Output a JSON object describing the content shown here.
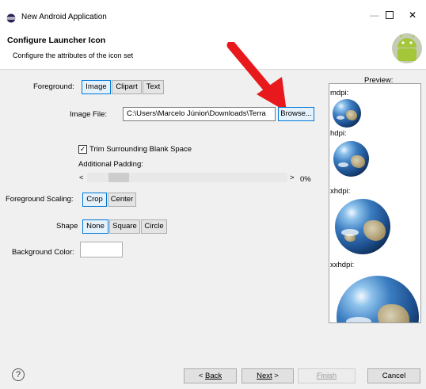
{
  "window": {
    "title": "New Android Application",
    "minimize_symbol": "—",
    "close_symbol": "✕"
  },
  "header": {
    "title": "Configure Launcher Icon",
    "subtitle": "Configure the attributes of the icon set"
  },
  "form": {
    "foreground_label": "Foreground:",
    "foreground_options": [
      "Image",
      "Clipart",
      "Text"
    ],
    "foreground_selected": "Image",
    "image_file_label": "Image File:",
    "image_file_value": "C:\\Users\\Marcelo Júnior\\Downloads\\Terra",
    "browse_label": "Browse...",
    "trim_checkbox_label": "Trim Surrounding Blank Space",
    "trim_checked": true,
    "check_mark": "✓",
    "additional_padding_label": "Additional Padding:",
    "slider_left_arrow": "<",
    "slider_right_arrow": ">",
    "padding_value": "0%",
    "foreground_scaling_label": "Foreground Scaling:",
    "scaling_options": [
      "Crop",
      "Center"
    ],
    "scaling_selected": "Crop",
    "shape_label": "Shape",
    "shape_options": [
      "None",
      "Square",
      "Circle"
    ],
    "shape_selected": "None",
    "background_color_label": "Background Color:",
    "background_color": "#ffffff"
  },
  "preview": {
    "title": "Preview:",
    "densities": [
      "mdpi:",
      "hdpi:",
      "xhdpi:",
      "xxhdpi:"
    ]
  },
  "footer": {
    "help_symbol": "?",
    "back_prefix": "< ",
    "back_label": "Back",
    "next_label": "Next",
    "next_suffix": " >",
    "finish_label": "Finish",
    "cancel_label": "Cancel"
  },
  "colors": {
    "accent": "#0078d7",
    "arrow": "#e8191c",
    "android_green": "#a4c639"
  },
  "icons": [
    "eclipse-icon",
    "android-logo-icon",
    "red-arrow-icon",
    "help-icon"
  ]
}
